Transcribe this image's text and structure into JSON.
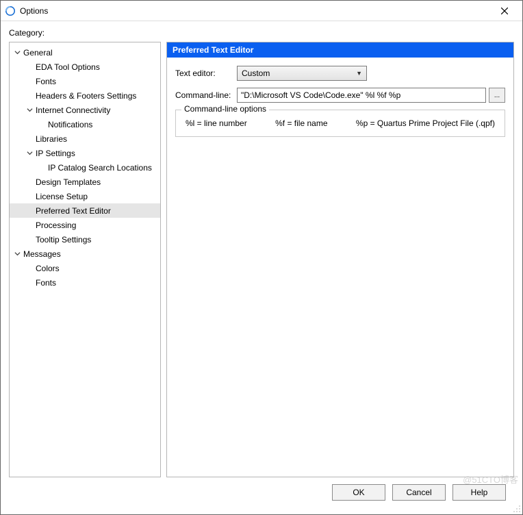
{
  "window": {
    "title": "Options"
  },
  "category_label": "Category:",
  "tree": [
    {
      "label": "General",
      "depth": 0,
      "expandable": true,
      "expanded": true,
      "selected": false
    },
    {
      "label": "EDA Tool Options",
      "depth": 1,
      "expandable": false,
      "selected": false
    },
    {
      "label": "Fonts",
      "depth": 1,
      "expandable": false,
      "selected": false
    },
    {
      "label": "Headers & Footers Settings",
      "depth": 1,
      "expandable": false,
      "selected": false
    },
    {
      "label": "Internet Connectivity",
      "depth": 1,
      "expandable": true,
      "expanded": true,
      "selected": false
    },
    {
      "label": "Notifications",
      "depth": 2,
      "expandable": false,
      "selected": false
    },
    {
      "label": "Libraries",
      "depth": 1,
      "expandable": false,
      "selected": false
    },
    {
      "label": "IP Settings",
      "depth": 1,
      "expandable": true,
      "expanded": true,
      "selected": false
    },
    {
      "label": "IP Catalog Search Locations",
      "depth": 2,
      "expandable": false,
      "selected": false
    },
    {
      "label": "Design Templates",
      "depth": 1,
      "expandable": false,
      "selected": false
    },
    {
      "label": "License Setup",
      "depth": 1,
      "expandable": false,
      "selected": false
    },
    {
      "label": "Preferred Text Editor",
      "depth": 1,
      "expandable": false,
      "selected": true
    },
    {
      "label": "Processing",
      "depth": 1,
      "expandable": false,
      "selected": false
    },
    {
      "label": "Tooltip Settings",
      "depth": 1,
      "expandable": false,
      "selected": false
    },
    {
      "label": "Messages",
      "depth": 0,
      "expandable": true,
      "expanded": true,
      "selected": false
    },
    {
      "label": "Colors",
      "depth": 1,
      "expandable": false,
      "selected": false
    },
    {
      "label": "Fonts",
      "depth": 1,
      "expandable": false,
      "selected": false
    }
  ],
  "panel": {
    "title": "Preferred Text Editor",
    "text_editor_label": "Text editor:",
    "text_editor_value": "Custom",
    "command_line_label": "Command-line:",
    "command_line_value": "\"D:\\Microsoft VS Code\\Code.exe\" %l %f %p",
    "browse_label": "...",
    "options_legend": "Command-line options",
    "opt_l": "%l = line number",
    "opt_f": "%f = file name",
    "opt_p": "%p = Quartus Prime Project File (.qpf)"
  },
  "buttons": {
    "ok": "OK",
    "cancel": "Cancel",
    "help": "Help"
  },
  "watermark": "@51CTO博客"
}
